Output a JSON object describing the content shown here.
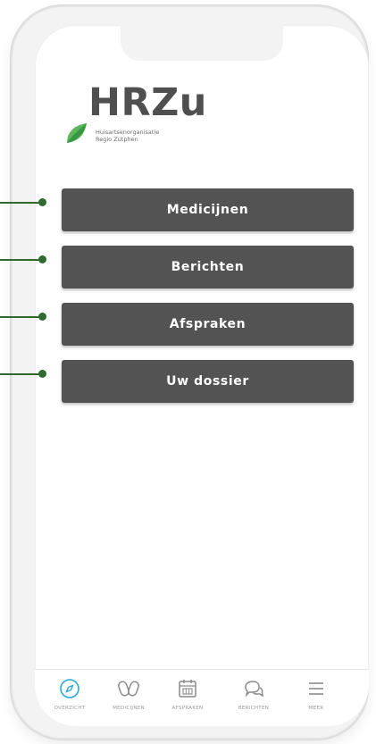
{
  "logo": {
    "name": "HRZu",
    "subtitle_line1": "Huisartsenorganisatie",
    "subtitle_line2": "Regio Zutphen"
  },
  "menu": {
    "buttons": [
      {
        "label": "Medicijnen"
      },
      {
        "label": "Berichten"
      },
      {
        "label": "Afspraken"
      },
      {
        "label": "Uw dossier"
      }
    ]
  },
  "tabbar": {
    "tabs": [
      {
        "label": "OVERZICHT",
        "icon": "compass-icon",
        "active": true
      },
      {
        "label": "MEDICIJNEN",
        "icon": "pills-icon",
        "active": false
      },
      {
        "label": "AFSPRAKEN",
        "icon": "calendar-icon",
        "active": false
      },
      {
        "label": "BERICHTEN",
        "icon": "chat-icon",
        "active": false
      },
      {
        "label": "MEER",
        "icon": "menu-icon",
        "active": false
      }
    ]
  },
  "colors": {
    "button_bg": "#535353",
    "accent_active": "#2aa8d8",
    "pointer": "#2f6b2f",
    "logo_green": "#5cb85c"
  }
}
